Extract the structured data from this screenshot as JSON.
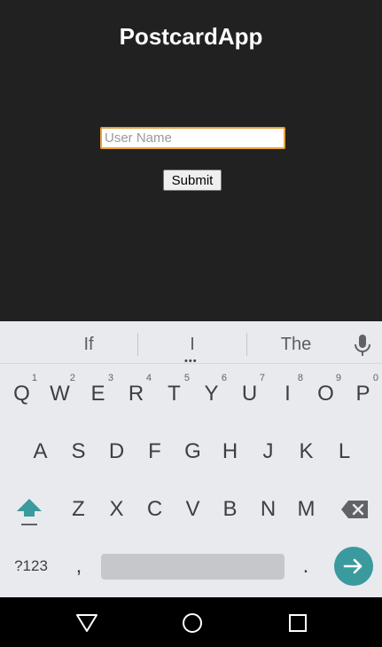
{
  "app": {
    "title": "PostcardApp",
    "username": {
      "value": "",
      "placeholder": "User Name"
    },
    "submit_label": "Submit"
  },
  "keyboard": {
    "suggestions": [
      "If",
      "I",
      "The"
    ],
    "row1": [
      {
        "key": "Q",
        "hint": "1"
      },
      {
        "key": "W",
        "hint": "2"
      },
      {
        "key": "E",
        "hint": "3"
      },
      {
        "key": "R",
        "hint": "4"
      },
      {
        "key": "T",
        "hint": "5"
      },
      {
        "key": "Y",
        "hint": "6"
      },
      {
        "key": "U",
        "hint": "7"
      },
      {
        "key": "I",
        "hint": "8"
      },
      {
        "key": "O",
        "hint": "9"
      },
      {
        "key": "P",
        "hint": "0"
      }
    ],
    "row2": [
      "A",
      "S",
      "D",
      "F",
      "G",
      "H",
      "J",
      "K",
      "L"
    ],
    "row3": [
      "Z",
      "X",
      "C",
      "V",
      "B",
      "N",
      "M"
    ],
    "symbols_label": "?123",
    "comma": ",",
    "period": ".",
    "accent_color": "#3b9a9e",
    "icons": [
      "mic-icon",
      "shift-icon",
      "backspace-icon",
      "enter-arrow-icon"
    ]
  },
  "navbar": {
    "icons": [
      "back-triangle-icon",
      "home-circle-icon",
      "recents-square-icon"
    ]
  }
}
